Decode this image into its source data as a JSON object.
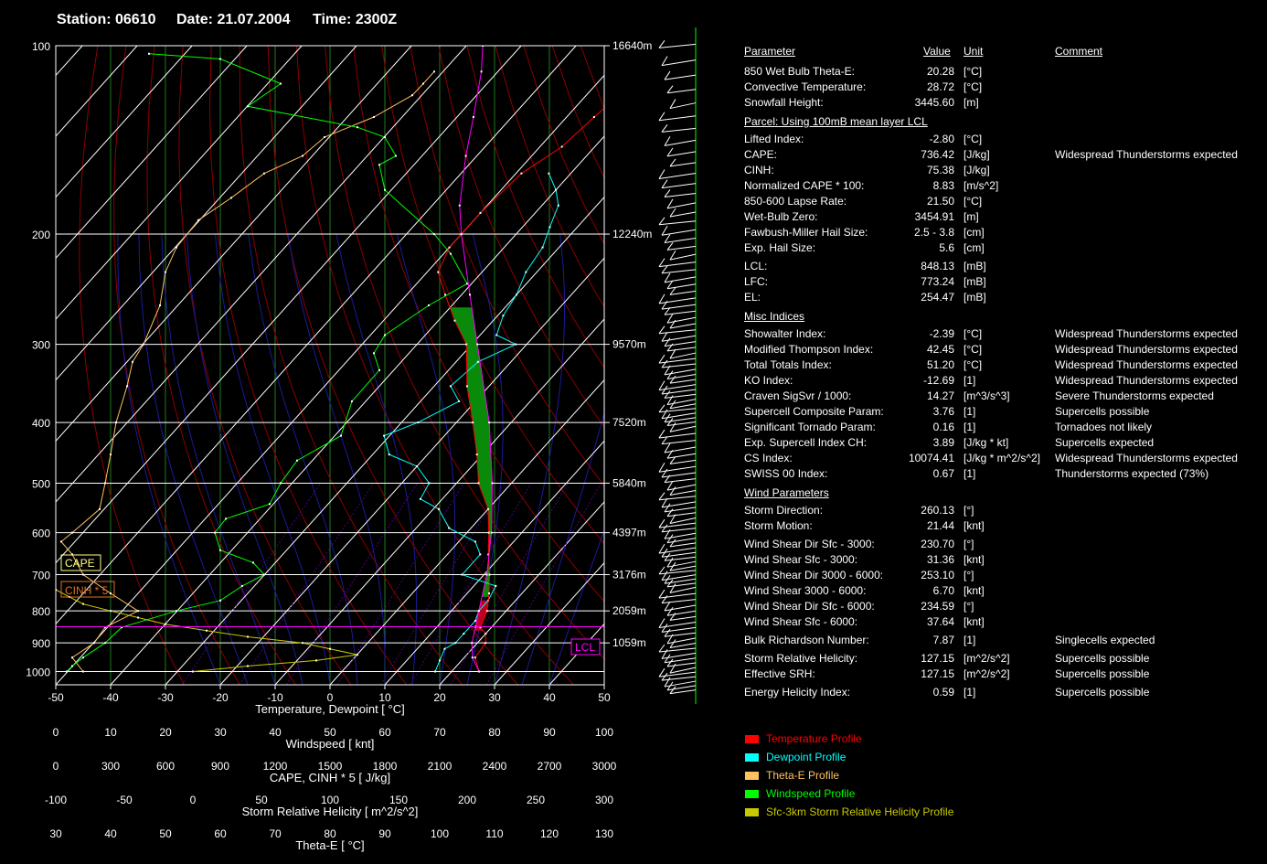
{
  "header": {
    "station": "Station: 06610",
    "date": "Date: 21.07.2004",
    "time": "Time: 2300Z"
  },
  "table": {
    "headers": {
      "parameter": "Parameter",
      "value": "Value",
      "unit": "Unit",
      "comment": "Comment"
    },
    "sections": [
      {
        "title": "",
        "rows": [
          {
            "name": "850 Wet Bulb Theta-E:",
            "value": "20.28",
            "unit": "[°C]",
            "comment": ""
          },
          {
            "name": "Convective Temperature:",
            "value": "28.72",
            "unit": "[°C]",
            "comment": ""
          },
          {
            "name": "Snowfall Height:",
            "value": "3445.60",
            "unit": "[m]",
            "comment": ""
          }
        ]
      },
      {
        "title": "Parcel: Using 100mB mean layer LCL",
        "rows": [
          {
            "name": "Lifted Index:",
            "value": "-2.80",
            "unit": "[°C]",
            "comment": ""
          },
          {
            "name": "CAPE:",
            "value": "736.42",
            "unit": "[J/kg]",
            "comment": "Widespread Thunderstorms expected"
          },
          {
            "name": "CINH:",
            "value": "75.38",
            "unit": "[J/kg]",
            "comment": ""
          },
          {
            "name": "Normalized CAPE * 100:",
            "value": "8.83",
            "unit": "[m/s^2]",
            "comment": ""
          },
          {
            "name": "850-600 Lapse Rate:",
            "value": "21.50",
            "unit": "[°C]",
            "comment": ""
          },
          {
            "name": "Wet-Bulb Zero:",
            "value": "3454.91",
            "unit": "[m]",
            "comment": ""
          },
          {
            "name": "Fawbush-Miller Hail Size:",
            "value": "2.5 - 3.8",
            "unit": "[cm]",
            "comment": ""
          },
          {
            "name": "Exp. Hail Size:",
            "value": "5.6",
            "unit": "[cm]",
            "comment": ""
          },
          {
            "name": "LCL:",
            "value": "848.13",
            "unit": "[mB]",
            "comment": "",
            "gap": true
          },
          {
            "name": "LFC:",
            "value": "773.24",
            "unit": "[mB]",
            "comment": ""
          },
          {
            "name": "EL:",
            "value": "254.47",
            "unit": "[mB]",
            "comment": ""
          }
        ]
      },
      {
        "title": "Misc Indices",
        "rows": [
          {
            "name": "Showalter Index:",
            "value": "-2.39",
            "unit": "[°C]",
            "comment": "Widespread Thunderstorms expected"
          },
          {
            "name": "Modified Thompson Index:",
            "value": "42.45",
            "unit": "[°C]",
            "comment": "Widespread Thunderstorms expected"
          },
          {
            "name": "Total Totals Index:",
            "value": "51.20",
            "unit": "[°C]",
            "comment": "Widespread Thunderstorms expected"
          },
          {
            "name": "KO Index:",
            "value": "-12.69",
            "unit": "[1]",
            "comment": "Widespread Thunderstorms expected"
          },
          {
            "name": "Craven SigSvr / 1000:",
            "value": "14.27",
            "unit": "[m^3/s^3]",
            "comment": "Severe Thunderstorms expected"
          },
          {
            "name": "Supercell Composite Param:",
            "value": "3.76",
            "unit": "[1]",
            "comment": "Supercells possible"
          },
          {
            "name": "Significant Tornado Param:",
            "value": "0.16",
            "unit": "[1]",
            "comment": "Tornadoes not likely"
          },
          {
            "name": "Exp. Supercell Index CH:",
            "value": "3.89",
            "unit": "[J/kg * kt]",
            "comment": "Supercells expected"
          },
          {
            "name": "CS Index:",
            "value": "10074.41",
            "unit": "[J/kg * m^2/s^2]",
            "comment": "Widespread Thunderstorms expected"
          },
          {
            "name": "SWISS 00 Index:",
            "value": "0.67",
            "unit": "[1]",
            "comment": "Thunderstorms expected (73%)"
          }
        ]
      },
      {
        "title": "Wind Parameters",
        "rows": [
          {
            "name": "Storm Direction:",
            "value": "260.13",
            "unit": "[°]",
            "comment": ""
          },
          {
            "name": "Storm Motion:",
            "value": "21.44",
            "unit": "[knt]",
            "comment": ""
          },
          {
            "name": "Wind Shear Dir Sfc - 3000:",
            "value": "230.70",
            "unit": "[°]",
            "comment": "",
            "gap": true
          },
          {
            "name": "Wind Shear Sfc - 3000:",
            "value": "31.36",
            "unit": "[knt]",
            "comment": ""
          },
          {
            "name": "Wind Shear Dir 3000 - 6000:",
            "value": "253.10",
            "unit": "[°]",
            "comment": ""
          },
          {
            "name": "Wind Shear 3000 - 6000:",
            "value": "6.70",
            "unit": "[knt]",
            "comment": ""
          },
          {
            "name": "Wind Shear Dir Sfc - 6000:",
            "value": "234.59",
            "unit": "[°]",
            "comment": ""
          },
          {
            "name": "Wind Shear Sfc - 6000:",
            "value": "37.64",
            "unit": "[knt]",
            "comment": ""
          },
          {
            "name": "Bulk Richardson Number:",
            "value": "7.87",
            "unit": "[1]",
            "comment": "Singlecells expected",
            "gap": true
          },
          {
            "name": "Storm Relative Helicity:",
            "value": "127.15",
            "unit": "[m^2/s^2]",
            "comment": "Supercells possible",
            "gap": true
          },
          {
            "name": "Effective SRH:",
            "value": "127.15",
            "unit": "[m^2/s^2]",
            "comment": "Supercells possible"
          },
          {
            "name": "Energy Helicity Index:",
            "value": "0.59",
            "unit": "[1]",
            "comment": "Supercells possible",
            "gap": true
          }
        ]
      }
    ]
  },
  "legend": [
    {
      "label": "Temperature Profile",
      "color": "#ff0000"
    },
    {
      "label": "Dewpoint Profile",
      "color": "#00ffff"
    },
    {
      "label": "Theta-E Profile",
      "color": "#ffc060"
    },
    {
      "label": "Windspeed Profile",
      "color": "#00ff00"
    },
    {
      "label": "Sfc-3km Storm Relative Helicity Profile",
      "color": "#c8c800"
    }
  ],
  "chart_data": {
    "type": "line",
    "pressure_axis": {
      "ticks": [
        100,
        200,
        300,
        400,
        500,
        600,
        700,
        800,
        900,
        1000
      ],
      "scale": "log",
      "range_hPa": [
        100,
        1050
      ]
    },
    "height_labels": [
      {
        "p": 100,
        "label": "16640m"
      },
      {
        "p": 200,
        "label": "12240m"
      },
      {
        "p": 300,
        "label": "9570m"
      },
      {
        "p": 400,
        "label": "7520m"
      },
      {
        "p": 500,
        "label": "5840m"
      },
      {
        "p": 600,
        "label": "4397m"
      },
      {
        "p": 700,
        "label": "3176m"
      },
      {
        "p": 800,
        "label": "2059m"
      },
      {
        "p": 900,
        "label": "1059m"
      }
    ],
    "box_labels": {
      "cape": "CAPE",
      "cinh": "CINH * 5",
      "lcl": "LCL"
    },
    "bottom_axes": [
      {
        "label": "Temperature, Dewpoint  [ °C]",
        "ticks": [
          "-50",
          "-40",
          "-30",
          "-20",
          "-10",
          "0",
          "10",
          "20",
          "30",
          "40",
          "50"
        ]
      },
      {
        "label": "Windspeed  [ knt]",
        "ticks": [
          "0",
          "10",
          "20",
          "30",
          "40",
          "50",
          "60",
          "70",
          "80",
          "90",
          "100"
        ]
      },
      {
        "label": "CAPE, CINH * 5  [ J/kg]",
        "ticks": [
          "0",
          "300",
          "600",
          "900",
          "1200",
          "1500",
          "1800",
          "2100",
          "2400",
          "2700",
          "3000"
        ]
      },
      {
        "label": "Storm Relative Helicity  [ m^2/s^2]",
        "ticks": [
          "-100",
          "-50",
          "0",
          "50",
          "100",
          "150",
          "200",
          "250",
          "300"
        ]
      },
      {
        "label": "Theta-E  [ °C]",
        "ticks": [
          "30",
          "40",
          "50",
          "60",
          "70",
          "80",
          "90",
          "100",
          "110",
          "120",
          "130"
        ]
      }
    ],
    "temp_range": [
      -50,
      50
    ],
    "wind_range": [
      0,
      100
    ],
    "thetae_range": [
      30,
      130
    ],
    "series": [
      {
        "key": "temperature",
        "color": "#ff0000",
        "points": [
          [
            1000,
            25
          ],
          [
            950,
            22
          ],
          [
            900,
            21.5
          ],
          [
            870,
            20
          ],
          [
            850,
            18
          ],
          [
            800,
            16.5
          ],
          [
            750,
            14
          ],
          [
            700,
            11
          ],
          [
            650,
            7.5
          ],
          [
            600,
            4
          ],
          [
            550,
            0
          ],
          [
            500,
            -6
          ],
          [
            450,
            -11
          ],
          [
            400,
            -17
          ],
          [
            350,
            -24
          ],
          [
            300,
            -31
          ],
          [
            275,
            -37
          ],
          [
            250,
            -43
          ],
          [
            230,
            -48
          ],
          [
            210,
            -50
          ],
          [
            185,
            -50
          ],
          [
            160,
            -49
          ],
          [
            145,
            -46
          ],
          [
            130,
            -45
          ],
          [
            120,
            -44
          ],
          [
            110,
            -41
          ],
          [
            105,
            -38
          ]
        ]
      },
      {
        "key": "dewpoint",
        "color": "#00ffff",
        "points": [
          [
            1000,
            17
          ],
          [
            960,
            16
          ],
          [
            920,
            15
          ],
          [
            900,
            16
          ],
          [
            870,
            16
          ],
          [
            830,
            16
          ],
          [
            800,
            15
          ],
          [
            770,
            15
          ],
          [
            730,
            14
          ],
          [
            700,
            6
          ],
          [
            650,
            6
          ],
          [
            620,
            3
          ],
          [
            590,
            -4
          ],
          [
            550,
            -9
          ],
          [
            530,
            -14
          ],
          [
            500,
            -15
          ],
          [
            470,
            -20
          ],
          [
            450,
            -27
          ],
          [
            420,
            -31
          ],
          [
            400,
            -27
          ],
          [
            370,
            -23
          ],
          [
            350,
            -27
          ],
          [
            320,
            -26
          ],
          [
            300,
            -22
          ],
          [
            290,
            -27
          ],
          [
            270,
            -29
          ],
          [
            250,
            -30
          ],
          [
            230,
            -32
          ],
          [
            210,
            -33
          ],
          [
            195,
            -35
          ],
          [
            180,
            -37
          ],
          [
            170,
            -40
          ],
          [
            160,
            -44
          ]
        ]
      },
      {
        "key": "parcel",
        "color": "#ff00ff",
        "points": [
          [
            1000,
            25
          ],
          [
            950,
            21.5
          ],
          [
            900,
            19
          ],
          [
            848,
            17
          ],
          [
            800,
            15
          ],
          [
            700,
            10.5
          ],
          [
            600,
            4.5
          ],
          [
            500,
            -3.5
          ],
          [
            400,
            -14
          ],
          [
            300,
            -29
          ],
          [
            250,
            -38.5
          ],
          [
            200,
            -50
          ],
          [
            180,
            -55
          ],
          [
            150,
            -62
          ],
          [
            130,
            -67
          ],
          [
            110,
            -73
          ],
          [
            100,
            -77
          ]
        ]
      },
      {
        "key": "windspeed",
        "color": "#00ff00",
        "points": [
          [
            1000,
            2
          ],
          [
            980,
            3
          ],
          [
            950,
            5
          ],
          [
            900,
            9
          ],
          [
            850,
            12
          ],
          [
            800,
            22
          ],
          [
            770,
            30
          ],
          [
            730,
            34
          ],
          [
            700,
            38
          ],
          [
            670,
            36
          ],
          [
            640,
            30
          ],
          [
            600,
            29
          ],
          [
            570,
            31
          ],
          [
            540,
            39
          ],
          [
            500,
            41
          ],
          [
            460,
            44
          ],
          [
            420,
            52
          ],
          [
            370,
            54
          ],
          [
            330,
            59
          ],
          [
            310,
            58
          ],
          [
            290,
            60
          ],
          [
            260,
            68
          ],
          [
            240,
            75
          ],
          [
            215,
            72
          ],
          [
            200,
            69
          ],
          [
            170,
            60
          ],
          [
            155,
            59
          ],
          [
            150,
            62
          ],
          [
            140,
            60
          ],
          [
            135,
            55
          ],
          [
            125,
            35
          ],
          [
            115,
            41
          ],
          [
            105,
            30
          ],
          [
            103,
            17
          ]
        ]
      },
      {
        "key": "thetae",
        "color": "#ffc060",
        "points": [
          [
            1000,
            35
          ],
          [
            950,
            33
          ],
          [
            900,
            37
          ],
          [
            850,
            39
          ],
          [
            800,
            45
          ],
          [
            750,
            40
          ],
          [
            700,
            35
          ],
          [
            650,
            33
          ],
          [
            620,
            31
          ],
          [
            600,
            33
          ],
          [
            550,
            38
          ],
          [
            500,
            39
          ],
          [
            450,
            40
          ],
          [
            400,
            41
          ],
          [
            350,
            43
          ],
          [
            320,
            44
          ],
          [
            300,
            46
          ],
          [
            260,
            49
          ],
          [
            230,
            50
          ],
          [
            210,
            52
          ],
          [
            190,
            56
          ],
          [
            175,
            62
          ],
          [
            160,
            68
          ],
          [
            150,
            75
          ],
          [
            140,
            79
          ],
          [
            130,
            88
          ],
          [
            120,
            95
          ],
          [
            115,
            97
          ],
          [
            110,
            99
          ]
        ]
      },
      {
        "key": "srh",
        "color": "#c8c800",
        "points": [
          [
            1000,
            0
          ],
          [
            980,
            40
          ],
          [
            960,
            90
          ],
          [
            940,
            120
          ],
          [
            920,
            100
          ],
          [
            900,
            80
          ],
          [
            880,
            40
          ],
          [
            860,
            10
          ],
          [
            840,
            -20
          ],
          [
            820,
            -40
          ],
          [
            800,
            -60
          ],
          [
            780,
            -80
          ],
          [
            760,
            -90
          ],
          [
            740,
            -100
          ]
        ]
      }
    ]
  }
}
